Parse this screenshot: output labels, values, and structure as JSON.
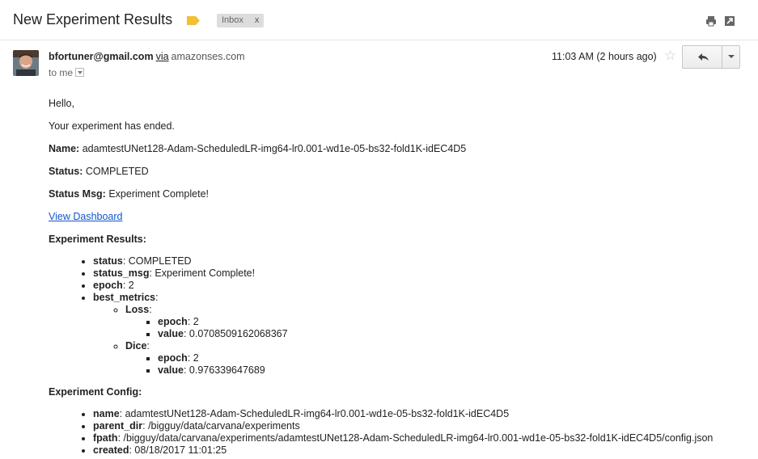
{
  "header": {
    "subject": "New Experiment Results",
    "label_chip": "Inbox",
    "label_chip_close": "x",
    "label_tag_color": "#f2c030",
    "print_icon": "print-icon",
    "popout_icon": "popout-icon"
  },
  "message": {
    "sender_email": "bfortuner@gmail.com",
    "via_text": "via",
    "via_domain": "amazonses.com",
    "to_text": "to me",
    "time": "11:03 AM (2 hours ago)",
    "star_icon": "☆",
    "reply_icon": "reply-icon",
    "more_icon": "chevron-down-icon"
  },
  "body": {
    "greeting": "Hello,",
    "intro": "Your experiment has ended.",
    "name_label": "Name:",
    "name_value": "adamtestUNet128-Adam-ScheduledLR-img64-lr0.001-wd1e-05-bs32-fold1K-idEC4D5",
    "status_label": "Status:",
    "status_value": "COMPLETED",
    "status_msg_label": "Status Msg:",
    "status_msg_value": "Experiment Complete!",
    "dashboard_link": "View Dashboard",
    "results_heading": "Experiment Results:",
    "results": {
      "status_key": "status",
      "status_val": ": COMPLETED",
      "status_msg_key": "status_msg",
      "status_msg_val": ": Experiment Complete!",
      "epoch_key": "epoch",
      "epoch_val": ": 2",
      "best_metrics_key": "best_metrics",
      "best_metrics_val": ":",
      "loss_key": "Loss",
      "loss_val": ":",
      "loss_epoch_key": "epoch",
      "loss_epoch_val": ": 2",
      "loss_value_key": "value",
      "loss_value_val": ": 0.0708509162068367",
      "dice_key": "Dice",
      "dice_val": ":",
      "dice_epoch_key": "epoch",
      "dice_epoch_val": ": 2",
      "dice_value_key": "value",
      "dice_value_val": ": 0.976339647689"
    },
    "config_heading": "Experiment Config:",
    "config": {
      "name_key": "name",
      "name_val": ": adamtestUNet128-Adam-ScheduledLR-img64-lr0.001-wd1e-05-bs32-fold1K-idEC4D5",
      "parent_dir_key": "parent_dir",
      "parent_dir_val": ": /bigguy/data/carvana/experiments",
      "fpath_key": "fpath",
      "fpath_val": ": /bigguy/data/carvana/experiments/adamtestUNet128-Adam-ScheduledLR-img64-lr0.001-wd1e-05-bs32-fold1K-idEC4D5/config.json",
      "created_key": "created",
      "created_val": ": 08/18/2017 11:01:25"
    }
  }
}
